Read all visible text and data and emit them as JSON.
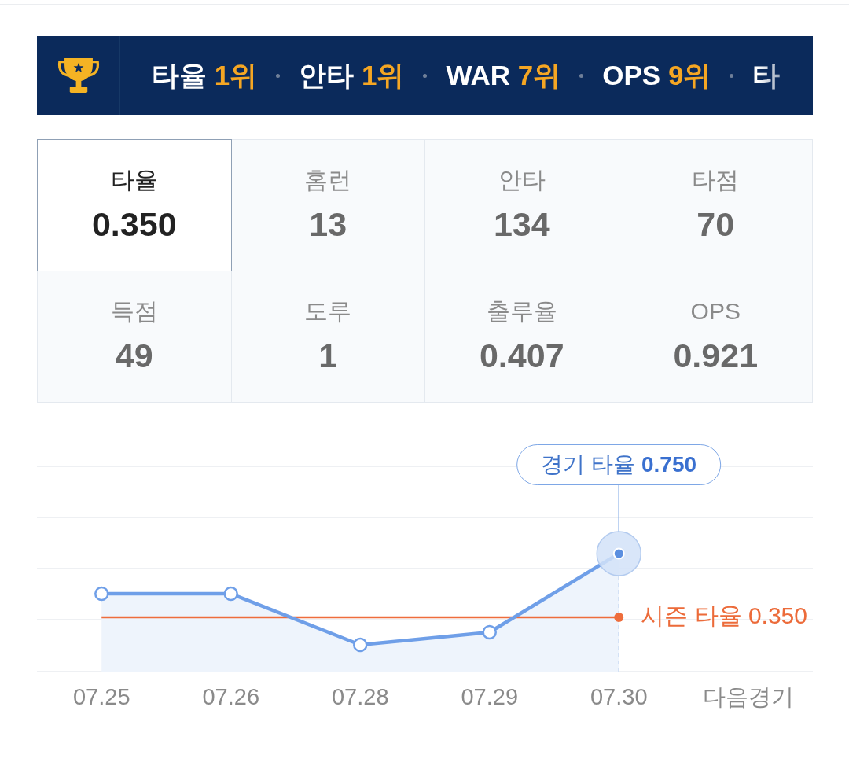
{
  "rank_banner": {
    "items": [
      {
        "label": "타율",
        "rank": "1위"
      },
      {
        "label": "안타",
        "rank": "1위"
      },
      {
        "label": "WAR",
        "rank": "7위"
      },
      {
        "label": "OPS",
        "rank": "9위"
      },
      {
        "label": "타"
      }
    ]
  },
  "stats": [
    {
      "label": "타율",
      "value": "0.350",
      "selected": true
    },
    {
      "label": "홈런",
      "value": "13",
      "selected": false
    },
    {
      "label": "안타",
      "value": "134",
      "selected": false
    },
    {
      "label": "타점",
      "value": "70",
      "selected": false
    },
    {
      "label": "득점",
      "value": "49",
      "selected": false
    },
    {
      "label": "도루",
      "value": "1",
      "selected": false
    },
    {
      "label": "출루율",
      "value": "0.407",
      "selected": false
    },
    {
      "label": "OPS",
      "value": "0.921",
      "selected": false
    }
  ],
  "chart": {
    "dates": [
      {
        "label": "07.25",
        "selected": false
      },
      {
        "label": "07.26",
        "selected": false
      },
      {
        "label": "07.28",
        "selected": false
      },
      {
        "label": "07.29",
        "selected": false
      },
      {
        "label": "07.30",
        "selected": true
      }
    ],
    "next_label": "다음경기",
    "game_callout": "경기 타율 **0.750**",
    "season_average": "시즌 타율 0.350"
  }
}
